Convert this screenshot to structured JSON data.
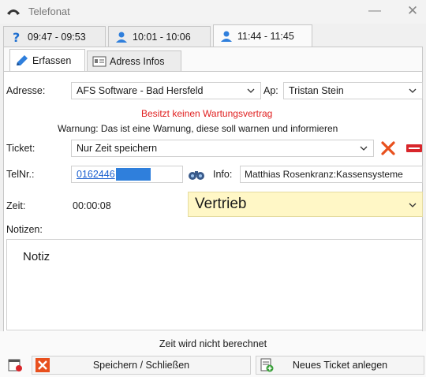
{
  "window": {
    "title": "Telefonat"
  },
  "call_tabs": [
    {
      "label": "09:47 - 09:53",
      "icon": "question-icon"
    },
    {
      "label": "10:01 - 10:06",
      "icon": "person-icon"
    },
    {
      "label": "11:44 - 11:45",
      "icon": "person-icon"
    }
  ],
  "sub_tabs": [
    {
      "label": "Erfassen",
      "icon": "pencil-icon"
    },
    {
      "label": "Adress Infos",
      "icon": "address-card-icon"
    }
  ],
  "form": {
    "address_label": "Adresse:",
    "address_value": "AFS Software - Bad Hersfeld",
    "contact_label": "Ap:",
    "contact_value": "Tristan Stein",
    "maintenance_warning": "Besitzt keinen Wartungsvertrag",
    "general_warning": "Warnung: Das ist eine Warnung, diese soll warnen und informieren",
    "ticket_label": "Ticket:",
    "ticket_value": "Nur Zeit speichern",
    "phone_label": "TelNr.:",
    "phone_value": "0162446",
    "info_label": "Info:",
    "info_value": "Matthias Rosenkranz:Kassensysteme",
    "time_label": "Zeit:",
    "time_value": "00:00:08",
    "category_value": "Vertrieb",
    "notes_label": "Notizen:",
    "notes_value": "Notiz"
  },
  "footer": {
    "status": "Zeit wird nicht berechnet",
    "save_label": "Speichern / Schließen",
    "new_ticket_label": "Neues Ticket anlegen"
  },
  "colors": {
    "accent_blue": "#2f7fdc",
    "warning_red": "#e02020",
    "category_bg": "#fff7c6",
    "close_orange": "#e8501e"
  }
}
